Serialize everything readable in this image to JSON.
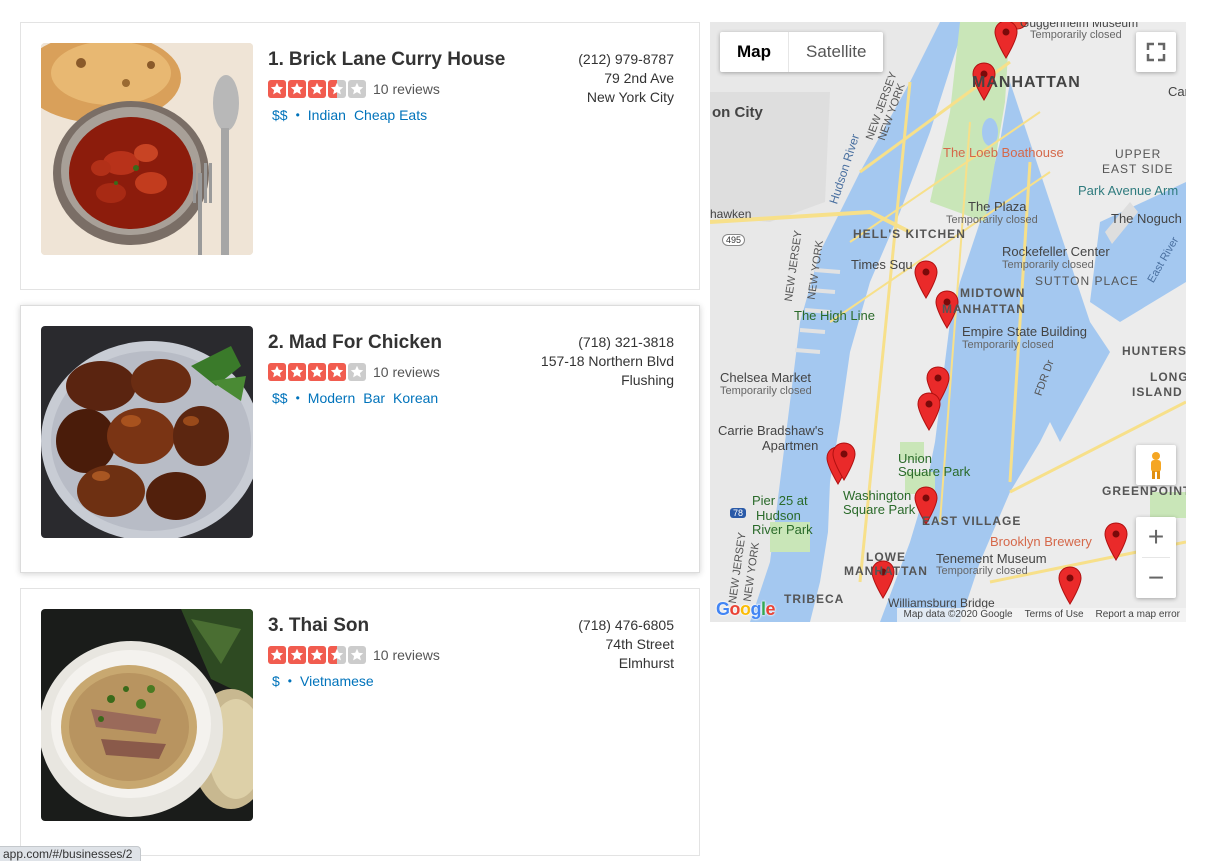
{
  "businesses": [
    {
      "number": "1.",
      "name": "Brick Lane Curry House",
      "rating": 3.5,
      "reviews": "10 reviews",
      "price": "$$",
      "categories": [
        "Indian",
        "Cheap Eats"
      ],
      "phone": "(212) 979-8787",
      "address1": "79 2nd Ave",
      "address2": "New York City"
    },
    {
      "number": "2.",
      "name": "Mad For Chicken",
      "rating": 4,
      "reviews": "10 reviews",
      "price": "$$",
      "categories": [
        "Modern",
        "Bar",
        "Korean"
      ],
      "phone": "(718) 321-3818",
      "address1": "157-18 Northern Blvd",
      "address2": "Flushing"
    },
    {
      "number": "3.",
      "name": "Thai Son",
      "rating": 3.5,
      "reviews": "10 reviews",
      "price": "$",
      "categories": [
        "Vietnamese"
      ],
      "phone": "(718) 476-6805",
      "address1": "74th Street",
      "address2": "Elmhurst"
    }
  ],
  "separator": "•",
  "map": {
    "type_map": "Map",
    "type_satellite": "Satellite",
    "zoom_in": "+",
    "zoom_out": "−",
    "logo": [
      "G",
      "o",
      "o",
      "g",
      "l",
      "e"
    ],
    "footer": [
      "Map data ©2020 Google",
      "Terms of Use",
      "Report a map error"
    ],
    "labels": {
      "manhattan": "MANHATTAN",
      "guggenheim": "Guggenheim Museum",
      "guggenheim_status": "Temporarily closed",
      "union_city": "on City",
      "loeb": "The Loeb Boathouse",
      "upper_east": "UPPER",
      "upper_east2": "EAST SIDE",
      "park_ave": "Park Avenue Arm",
      "plaza": "The Plaza",
      "plaza_status": "Temporarily closed",
      "noguchi": "The Noguch",
      "weehawken": "hawken",
      "hells_kitchen": "HELL'S KITCHEN",
      "rockefeller": "Rockefeller Center",
      "rockefeller_status": "Temporarily closed",
      "times_sq": "Times Squ",
      "sutton": "SUTTON PLACE",
      "high_line": "The High Line",
      "midtown": "MIDTOWN",
      "midtown2": "MANHATTAN",
      "empire": "Empire State Building",
      "empire_status": "Temporarily closed",
      "hunters": "HUNTERS PO",
      "long_island": "LONG",
      "long_island2": "ISLAND C",
      "chelsea": "Chelsea Market",
      "chelsea_status": "Temporarily closed",
      "carrie": "Carrie Bradshaw's",
      "carrie2": "Apartmen",
      "union_sq": "Union",
      "union_sq2": "Square Park",
      "washington": "Washington",
      "washington2": "Square Park",
      "pier": "Pier 25 at",
      "pier2": "Hudson",
      "pier3": "River Park",
      "east_village": "EAST VILLAGE",
      "greenpoint": "GREENPOINT",
      "brooklyn_brewery": "Brooklyn Brewery",
      "tenement": "Tenement Museum",
      "tenement_status": "Temporarily closed",
      "lower_manhattan": "LOWE",
      "lower_manhattan2": "MANHATTAN",
      "tribeca": "TRIBECA",
      "williamsburg": "Williamsburg Bridge",
      "hudson_river": "Hudson River",
      "east_river": "East River",
      "new_jersey": "NEW JERSEY",
      "new_york": "NEW YORK",
      "carl": "Carl",
      "fdr": "FDR Dr",
      "i495": "495",
      "i78": "78",
      "nj_top": "NEW JERSEY",
      "ny_top": "NEW YORK",
      "nj_bottom": "NEW JERSEY",
      "ny_bottom": "NEW YORK"
    }
  },
  "status_url": "app.com/#/businesses/2"
}
